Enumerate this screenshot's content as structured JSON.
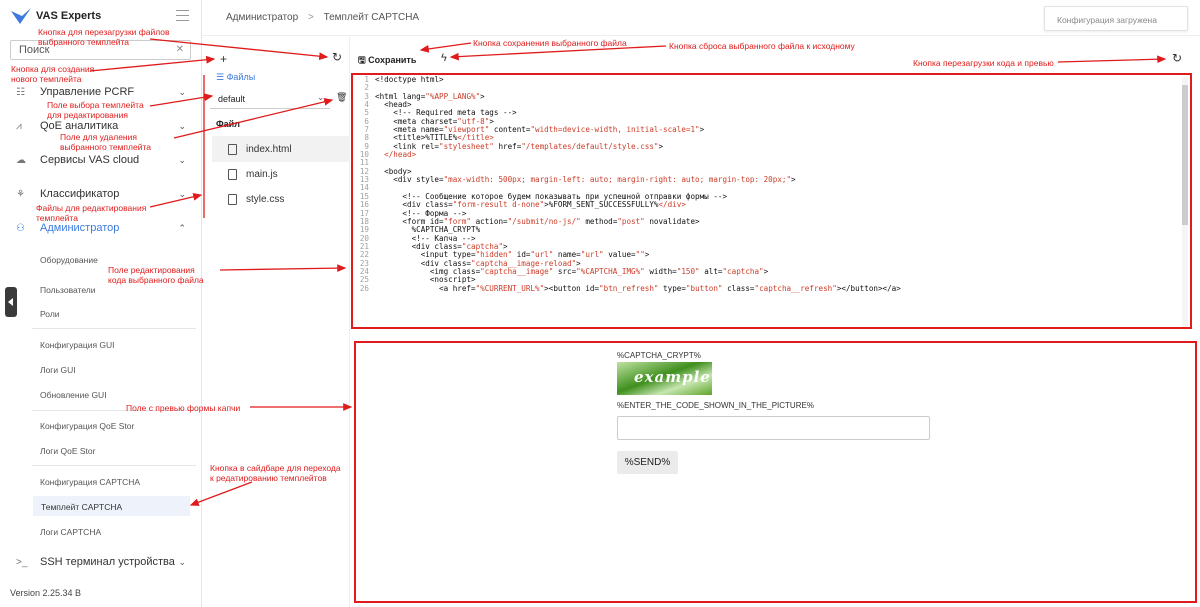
{
  "sidebar": {
    "logo_text": "VAS Experts",
    "search_placeholder": "Поиск",
    "nav": [
      "Управление PCRF",
      "QoE аналитика",
      "Сервисы VAS cloud",
      "Классификатор",
      "Администратор"
    ],
    "admin_items": [
      "Оборудование",
      "Пользователи",
      "Роли",
      "Конфигурация GUI",
      "Логи GUI",
      "Обновление GUI",
      "Конфигурация QoE Stor",
      "Логи QoE Stor",
      "Конфигурация CAPTCHA",
      "Темплейт CAPTCHA",
      "Логи CAPTCHA"
    ],
    "ssh": "SSH терминал устройства",
    "version": "Version 2.25.34 B"
  },
  "topbar": {
    "crumb_root": "Администратор",
    "crumb_sep": ">",
    "crumb_page": "Темплейт CAPTCHA",
    "status": "Конфигурация загружена"
  },
  "templates": {
    "files_label": "Файлы",
    "selected": "default",
    "file_header": "Файл",
    "files": [
      "index.html",
      "main.js",
      "style.css"
    ]
  },
  "editor": {
    "save_label": "Сохранить",
    "line_numbers": [
      "1",
      "2",
      "3",
      "4",
      "5",
      "6",
      "7",
      "8",
      "9",
      "10",
      "11",
      "12",
      "13",
      "14",
      "15",
      "16",
      "17",
      "18",
      "19",
      "20",
      "21",
      "22",
      "23",
      "24",
      "25",
      "26"
    ],
    "lines": [
      "<!doctype html>",
      "",
      "<html lang=\"%APP_LANG%\">",
      "  <head>",
      "    <!-- Required meta tags -->",
      "    <meta charset=\"utf-8\">",
      "    <meta name=\"viewport\" content=\"width=device-width, initial-scale=1\">",
      "    <title>%TITLE%</title>",
      "    <link rel=\"stylesheet\" href=\"/templates/default/style.css\">",
      "  </head>",
      "",
      "  <body>",
      "    <div style=\"max-width: 500px; margin-left: auto; margin-right: auto; margin-top: 20px;\">",
      "",
      "      <!-- Сообщение которое будем показывать при успешной отправки формы -->",
      "      <div class=\"form-result d-none\">%FORM_SENT_SUCCESSFULLY%</div>",
      "      <!-- Форма -->",
      "      <form id=\"form\" action=\"/submit/no-js/\" method=\"post\" novalidate>",
      "        %CAPTCHA_CRYPT%",
      "        <!-- Капча -->",
      "        <div class=\"captcha\">",
      "          <input type=\"hidden\" id=\"url\" name=\"url\" value=\"\">",
      "          <div class=\"captcha__image-reload\">",
      "            <img class=\"captcha__image\" src=\"%CAPTCHA_IMG%\" width=\"150\" alt=\"captcha\">",
      "            <noscript>",
      "              <a href=\"%CURRENT_URL%\"><button id=\"btn_refresh\" type=\"button\" class=\"captcha__refresh\"></button></a>"
    ]
  },
  "preview": {
    "crypt": "%CAPTCHA_CRYPT%",
    "captcha_word": "example",
    "enter_code": "%ENTER_THE_CODE_SHOWN_IN_THE_PICTURE%",
    "send": "%SEND%"
  },
  "annotations": {
    "reload_tpl": "Кнопка для перезагрузки файлов\nвыбранного темплейта",
    "create_tpl": "Кнопка для создания\nнового темплейта",
    "select_tpl": "Поле выбора темплейта\nдля редактирования",
    "delete_tpl": "Поле для удаления\nвыбранного темплейта",
    "files_edit": "Файлы для редактирования\nтемплейта",
    "code_field": "Поле редактирования\nкода выбранного файла",
    "preview_field": "Поле с превью формы капчи",
    "sidebar_btn": "Кнопка в сайдбаре для перехода\nк редатированию темплейтов",
    "save_btn": "Кнопка сохранения выбранного файла",
    "reset_btn": "Кнопка сброса выбранного файла к исходному",
    "reload_code": "Кнопка перезагрузки кода и превью"
  },
  "colors": {
    "accent": "#3d7be0",
    "annotation": "#e01b1b"
  }
}
